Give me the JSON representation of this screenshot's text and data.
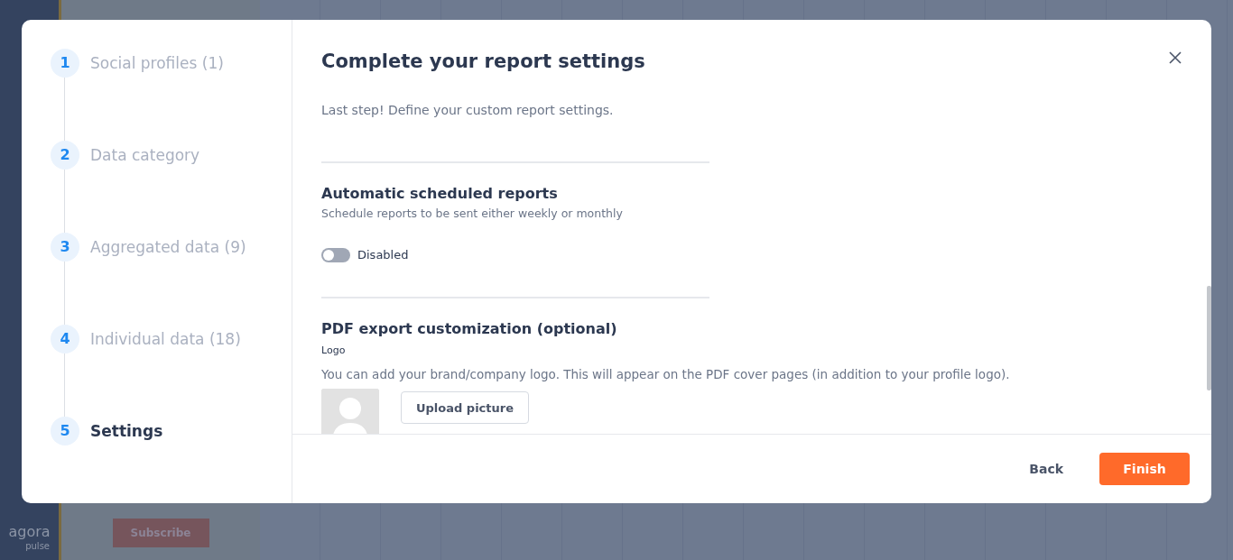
{
  "background": {
    "logo": {
      "main": "agora",
      "sub": "pulse"
    },
    "subscribe_button": "Subscribe"
  },
  "modal": {
    "steps": [
      {
        "number": "1",
        "label": "Social profiles (1)",
        "selected": false
      },
      {
        "number": "2",
        "label": "Data category",
        "selected": false
      },
      {
        "number": "3",
        "label": "Aggregated data (9)",
        "selected": false
      },
      {
        "number": "4",
        "label": "Individual data (18)",
        "selected": false
      },
      {
        "number": "5",
        "label": "Settings",
        "selected": true
      }
    ],
    "title": "Complete your report settings",
    "subtitle": "Last step! Define your custom report settings.",
    "scheduled": {
      "heading": "Automatic scheduled reports",
      "description": "Schedule reports to be sent either weekly or monthly",
      "toggle": {
        "on": false,
        "label": "Disabled"
      }
    },
    "pdf": {
      "heading": "PDF export customization (optional)",
      "logo_label": "Logo",
      "description": "You can add your brand/company logo. This will appear on the PDF cover pages (in addition to your profile logo).",
      "upload_button": "Upload picture"
    },
    "footer": {
      "back": "Back",
      "finish": "Finish"
    }
  }
}
